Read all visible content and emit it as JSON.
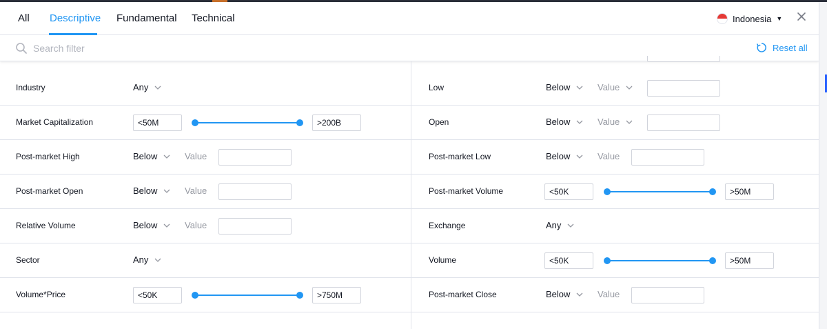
{
  "tabs": [
    {
      "label": "All",
      "active": false
    },
    {
      "label": "Descriptive",
      "active": true
    },
    {
      "label": "Fundamental",
      "active": false
    },
    {
      "label": "Technical",
      "active": false
    }
  ],
  "country": {
    "label": "Indonesia",
    "flag_colors": [
      "#e53935",
      "#ffffff"
    ]
  },
  "search": {
    "placeholder": "Search filter",
    "value": ""
  },
  "reset_label": "Reset all",
  "colors": {
    "accent": "#2196f3",
    "border": "#e0e3eb",
    "muted": "#9598a1"
  },
  "icons": [
    "close-icon",
    "search-icon",
    "reset-icon",
    "chevron-down-icon",
    "caret-down-icon"
  ],
  "left_filters": [
    {
      "label": "Industry",
      "type": "select",
      "value": "Any"
    },
    {
      "label": "Market Capitalization",
      "type": "range",
      "min": "<50M",
      "max": ">200B"
    },
    {
      "label": "Post-market High",
      "type": "compare",
      "operator": "Below",
      "value_label": "Value",
      "value": ""
    },
    {
      "label": "Post-market Open",
      "type": "compare",
      "operator": "Below",
      "value_label": "Value",
      "value": ""
    },
    {
      "label": "Relative Volume",
      "type": "compare",
      "operator": "Below",
      "value_label": "Value",
      "value": ""
    },
    {
      "label": "Sector",
      "type": "select",
      "value": "Any"
    },
    {
      "label": "Volume*Price",
      "type": "range",
      "min": "<50K",
      "max": ">750M"
    }
  ],
  "right_filters": [
    {
      "label": "Low",
      "type": "compare",
      "operator": "Below",
      "value_label": "Value",
      "value_dropdown": true,
      "value": ""
    },
    {
      "label": "Open",
      "type": "compare",
      "operator": "Below",
      "value_label": "Value",
      "value_dropdown": true,
      "value": ""
    },
    {
      "label": "Post-market Low",
      "type": "compare",
      "operator": "Below",
      "value_label": "Value",
      "value": ""
    },
    {
      "label": "Post-market Volume",
      "type": "range",
      "min": "<50K",
      "max": ">50M"
    },
    {
      "label": "Exchange",
      "type": "select",
      "value": "Any"
    },
    {
      "label": "Volume",
      "type": "range",
      "min": "<50K",
      "max": ">50M"
    },
    {
      "label": "Post-market Close",
      "type": "compare",
      "operator": "Below",
      "value_label": "Value",
      "value": ""
    }
  ]
}
